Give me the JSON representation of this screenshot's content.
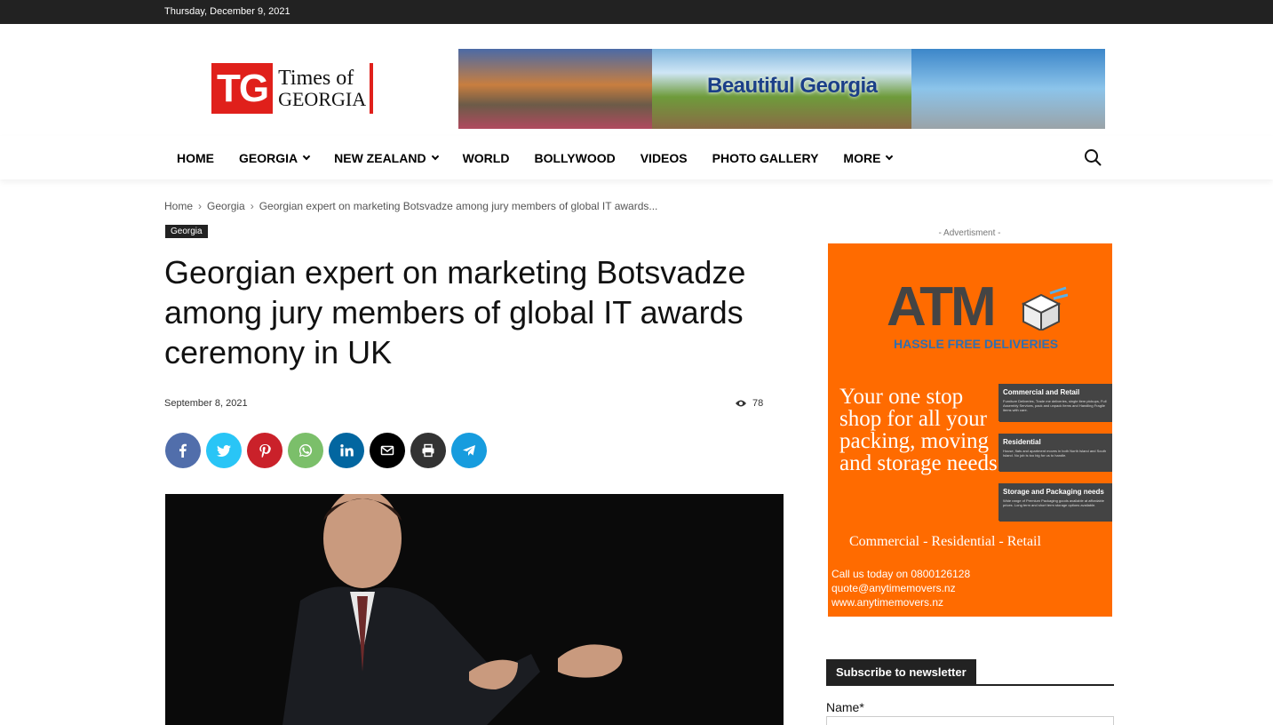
{
  "topbar": {
    "date": "Thursday, December 9, 2021"
  },
  "logo": {
    "mark": "TG",
    "line1": "Times of",
    "line2": "GEORGIA"
  },
  "banner": {
    "text": "Beautiful Georgia"
  },
  "nav": {
    "items": [
      {
        "label": "HOME",
        "dropdown": false
      },
      {
        "label": "GEORGIA",
        "dropdown": true
      },
      {
        "label": "NEW ZEALAND",
        "dropdown": true
      },
      {
        "label": "WORLD",
        "dropdown": false
      },
      {
        "label": "BOLLYWOOD",
        "dropdown": false
      },
      {
        "label": "VIDEOS",
        "dropdown": false
      },
      {
        "label": "PHOTO GALLERY",
        "dropdown": false
      },
      {
        "label": "MORE",
        "dropdown": true
      }
    ],
    "search_icon": "search-icon"
  },
  "breadcrumb": {
    "home": "Home",
    "sep": "›",
    "category": "Georgia",
    "current": "Georgian expert on marketing Botsvadze among jury members of global IT awards..."
  },
  "article": {
    "category": "Georgia",
    "title": "Georgian expert on marketing Botsvadze among jury members of global IT awards ceremony in UK",
    "date": "September 8, 2021",
    "views": "78"
  },
  "share": [
    {
      "name": "facebook",
      "color": "#516eab",
      "glyph": "f"
    },
    {
      "name": "twitter",
      "color": "#29c5f6",
      "glyph": "t"
    },
    {
      "name": "pinterest",
      "color": "#ca212a",
      "glyph": "p"
    },
    {
      "name": "whatsapp",
      "color": "#7bbf6a",
      "glyph": "w"
    },
    {
      "name": "linkedin",
      "color": "#0266a0",
      "glyph": "in"
    },
    {
      "name": "email",
      "color": "#000000",
      "glyph": "✉"
    },
    {
      "name": "print",
      "color": "#333333",
      "glyph": "⎙"
    },
    {
      "name": "telegram",
      "color": "#179cde",
      "glyph": "➤"
    }
  ],
  "sidebar": {
    "ad_label": "- Advertisment -",
    "ad": {
      "brand": "ATM",
      "tagline": "HASSLE FREE DELIVERIES",
      "headline": "Your one stop shop for all your packing, moving and storage needs",
      "services": [
        {
          "title": "Commercial and Retail",
          "body": "Furniture Deliveries, Trade me deliveries, single item pickups, Full Assembly Services, pack and unpack items and Handling Fragile items with care."
        },
        {
          "title": "Residential",
          "body": "House, flats and apartment moves in both North Island and South Island. No job is too big for us to handle."
        },
        {
          "title": "Storage and Packaging needs",
          "body": "Wide range of Premium Packaging goods available at affordable prices. Long term and short term storage options available."
        }
      ],
      "segments": "Commercial - Residential - Retail",
      "contact_line1": "Call us today on 0800126128",
      "contact_line2": "quote@anytimemovers.nz",
      "contact_line3": "www.anytimemovers.nz"
    },
    "newsletter_title": "Subscribe to newsletter",
    "name_label": "Name*"
  }
}
